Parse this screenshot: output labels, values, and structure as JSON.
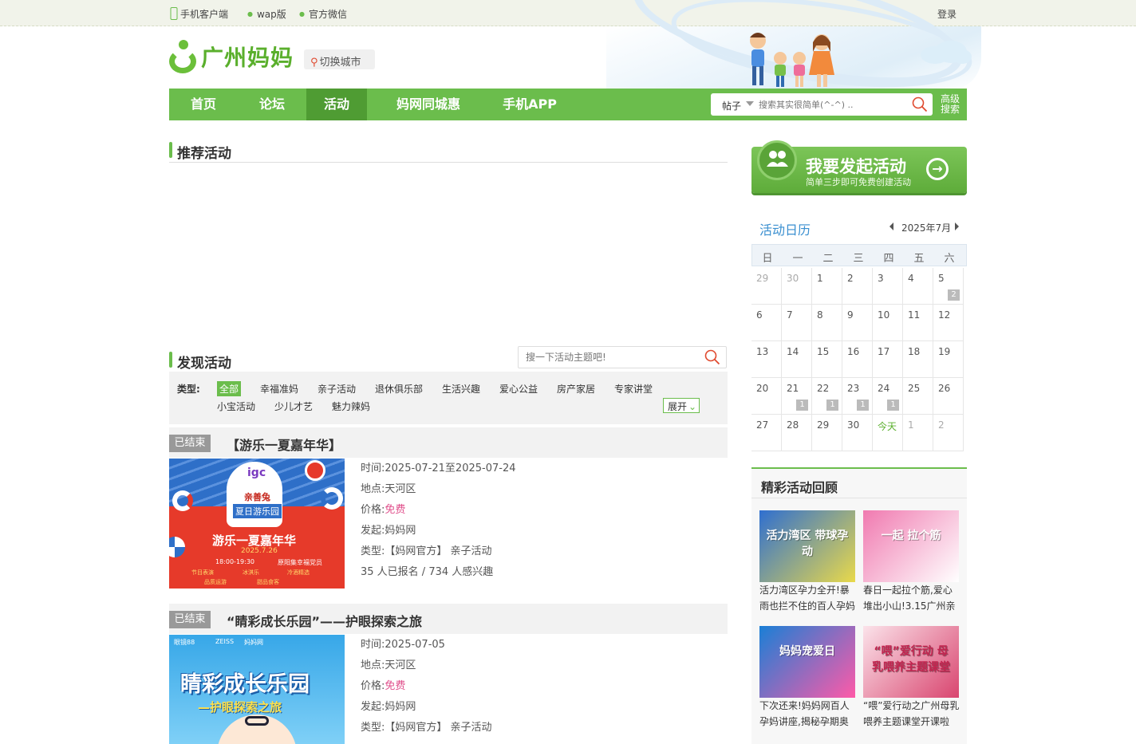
{
  "topbar": {
    "mobile": "手机客户端",
    "wap": "wap版",
    "wechat": "官方微信",
    "login": "登录"
  },
  "brand": {
    "logo": "广州妈妈",
    "city_switch": "切换城市"
  },
  "nav": {
    "items": [
      "首页",
      "论坛",
      "活动",
      "妈网同城惠",
      "手机APP"
    ],
    "active": "活动"
  },
  "search": {
    "scope": "帖子",
    "placeholder": "搜索其实很简单(^-^) ..",
    "advanced": "高级搜索"
  },
  "recommend": {
    "title": "推荐活动"
  },
  "discover": {
    "title": "发现活动",
    "search_placeholder": "搜一下活动主题吧!",
    "type_label": "类型:",
    "types": [
      "全部",
      "幸福准妈",
      "亲子活动",
      "退休俱乐部",
      "生活兴趣",
      "爱心公益",
      "房产家居",
      "专家讲堂"
    ],
    "types_row2": [
      "小宝活动",
      "少儿才艺",
      "魅力辣妈"
    ],
    "expand": "展开"
  },
  "activities": [
    {
      "status": "已结束",
      "title": "【游乐一夏嘉年华】",
      "time": "时间:2025-07-21至2025-07-24",
      "place": "地点:天河区",
      "price_label": "价格:",
      "price": "免费",
      "host": "发起:妈妈网",
      "type": "类型:【妈网官方】 亲子活动",
      "stats": "35 人已报名 / 734 人感兴趣",
      "poster": {
        "tag": "igc",
        "brand": "亲善兔",
        "park": "夏日游乐园",
        "headline": "游乐一夏嘉年华",
        "date": "2025.7.26",
        "time": "18:00-19:30",
        "venue": "原阳集幸福党员",
        "bottom1": "节目表演",
        "bottom2": "冰淇乐",
        "bottom3": "冷酒精选",
        "bottom4": "品质运游",
        "bottom5": "甜品食客"
      }
    },
    {
      "status": "已结束",
      "title": "“睛彩成长乐园”——护眼探索之旅",
      "time": "时间:2025-07-05",
      "place": "地点:天河区",
      "price_label": "价格:",
      "price": "免费",
      "host": "发起:妈妈网",
      "type": "类型:【妈网官方】 亲子活动",
      "poster": {
        "brand1": "眼镜88",
        "brand2": "ZEISS",
        "brand3": "妈妈网",
        "headline": "睛彩成长乐园",
        "sub": "—护眼探索之旅"
      }
    }
  ],
  "cta": {
    "title": "我要发起活动",
    "subtitle": "简单三步即可免费创建活动"
  },
  "calendar": {
    "title": "活动日历",
    "month": "2025年7月",
    "weekdays": [
      "日",
      "一",
      "二",
      "三",
      "四",
      "五",
      "六"
    ],
    "weeks": [
      [
        {
          "d": "29",
          "g": true
        },
        {
          "d": "30",
          "g": true
        },
        {
          "d": "1"
        },
        {
          "d": "2"
        },
        {
          "d": "3"
        },
        {
          "d": "4"
        },
        {
          "d": "5",
          "n": "2"
        }
      ],
      [
        {
          "d": "6"
        },
        {
          "d": "7"
        },
        {
          "d": "8"
        },
        {
          "d": "9"
        },
        {
          "d": "10"
        },
        {
          "d": "11"
        },
        {
          "d": "12"
        }
      ],
      [
        {
          "d": "13"
        },
        {
          "d": "14"
        },
        {
          "d": "15"
        },
        {
          "d": "16"
        },
        {
          "d": "17"
        },
        {
          "d": "18"
        },
        {
          "d": "19"
        }
      ],
      [
        {
          "d": "20"
        },
        {
          "d": "21",
          "n": "1"
        },
        {
          "d": "22",
          "n": "1"
        },
        {
          "d": "23",
          "n": "1"
        },
        {
          "d": "24",
          "n": "1"
        },
        {
          "d": "25"
        },
        {
          "d": "26"
        }
      ],
      [
        {
          "d": "27"
        },
        {
          "d": "28"
        },
        {
          "d": "29"
        },
        {
          "d": "30"
        },
        {
          "d": "今天",
          "today": true
        },
        {
          "d": "1",
          "g": true
        },
        {
          "d": "2",
          "g": true
        }
      ]
    ]
  },
  "review": {
    "title": "精彩活动回顾",
    "items": [
      {
        "caption": "活力湾区孕力全开!暴雨也拦不住的百人孕妈",
        "poster": "活力湾区 带球孕动",
        "colors": [
          "#2f6fd0",
          "#e9d94a"
        ]
      },
      {
        "caption": "春日一起拉个筋,爱心堆出小山!3.15广州亲",
        "poster": "一起 拉个筋",
        "colors": [
          "#f07ab0",
          "#ffffff"
        ]
      },
      {
        "caption": "下次还来!妈妈网百人孕妈讲座,揭秘孕期奥",
        "poster": "妈妈宠爱日",
        "colors": [
          "#1a7fd6",
          "#ff5aa8"
        ]
      },
      {
        "caption": "“喂”爱行动之广州母乳喂养主题课堂开课啦",
        "poster": "“喂”爱行动 母乳喂养主题课堂",
        "colors": [
          "#fbe3ea",
          "#d9456f"
        ]
      }
    ]
  }
}
